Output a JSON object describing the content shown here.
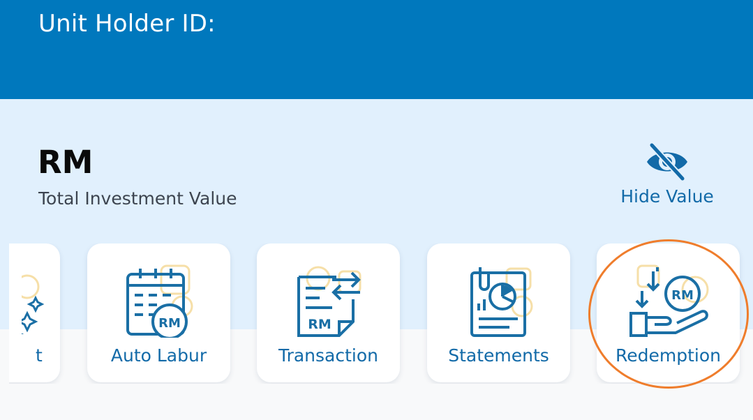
{
  "header": {
    "title": "Unit Holder ID:"
  },
  "summary": {
    "value": "RM",
    "value_label": "Total Investment Value",
    "hide_label": "Hide Value",
    "hide_icon": "eye-off-icon"
  },
  "menu": {
    "items": [
      {
        "label": "t",
        "icon": "sparkle-icon"
      },
      {
        "label": "Auto Labur",
        "icon": "calendar-rm-icon",
        "badge": "RM"
      },
      {
        "label": "Transaction",
        "icon": "document-transfer-icon",
        "badge": "RM"
      },
      {
        "label": "Statements",
        "icon": "report-chart-icon"
      },
      {
        "label": "Redemption",
        "icon": "hand-rm-coin-icon",
        "badge": "RM",
        "highlighted": true
      }
    ]
  },
  "colors": {
    "header_bg": "#0078bd",
    "summary_bg": "#e1f0fd",
    "accent": "#126aa8",
    "icon_blue": "#1a6fa5",
    "highlight_ring": "#ef7d2c"
  }
}
